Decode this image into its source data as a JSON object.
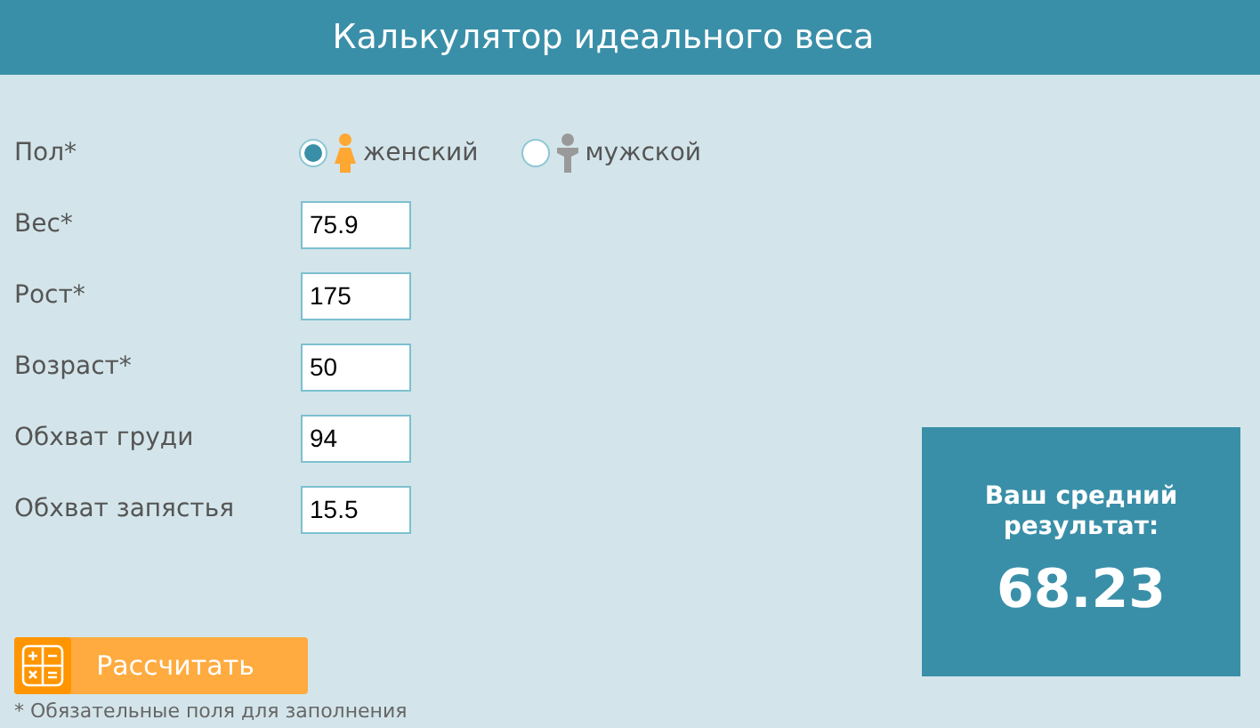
{
  "title": "Калькулятор идеального веса",
  "gender": {
    "label": "Пол*",
    "options": [
      {
        "label": "женский",
        "kind": "female",
        "selected": true
      },
      {
        "label": "мужской",
        "kind": "male",
        "selected": false
      }
    ]
  },
  "fields": [
    {
      "label": "Вес*",
      "value": "75.9"
    },
    {
      "label": "Рост*",
      "value": "175"
    },
    {
      "label": "Возраст*",
      "value": "50"
    },
    {
      "label": "Обхват груди",
      "value": "94"
    },
    {
      "label": "Обхват запястья",
      "value": "15.5"
    }
  ],
  "button": "Рассчитать",
  "note": "* Обязательные поля для заполнения",
  "result": {
    "label": "Ваш средний результат:",
    "value": "68.23"
  }
}
